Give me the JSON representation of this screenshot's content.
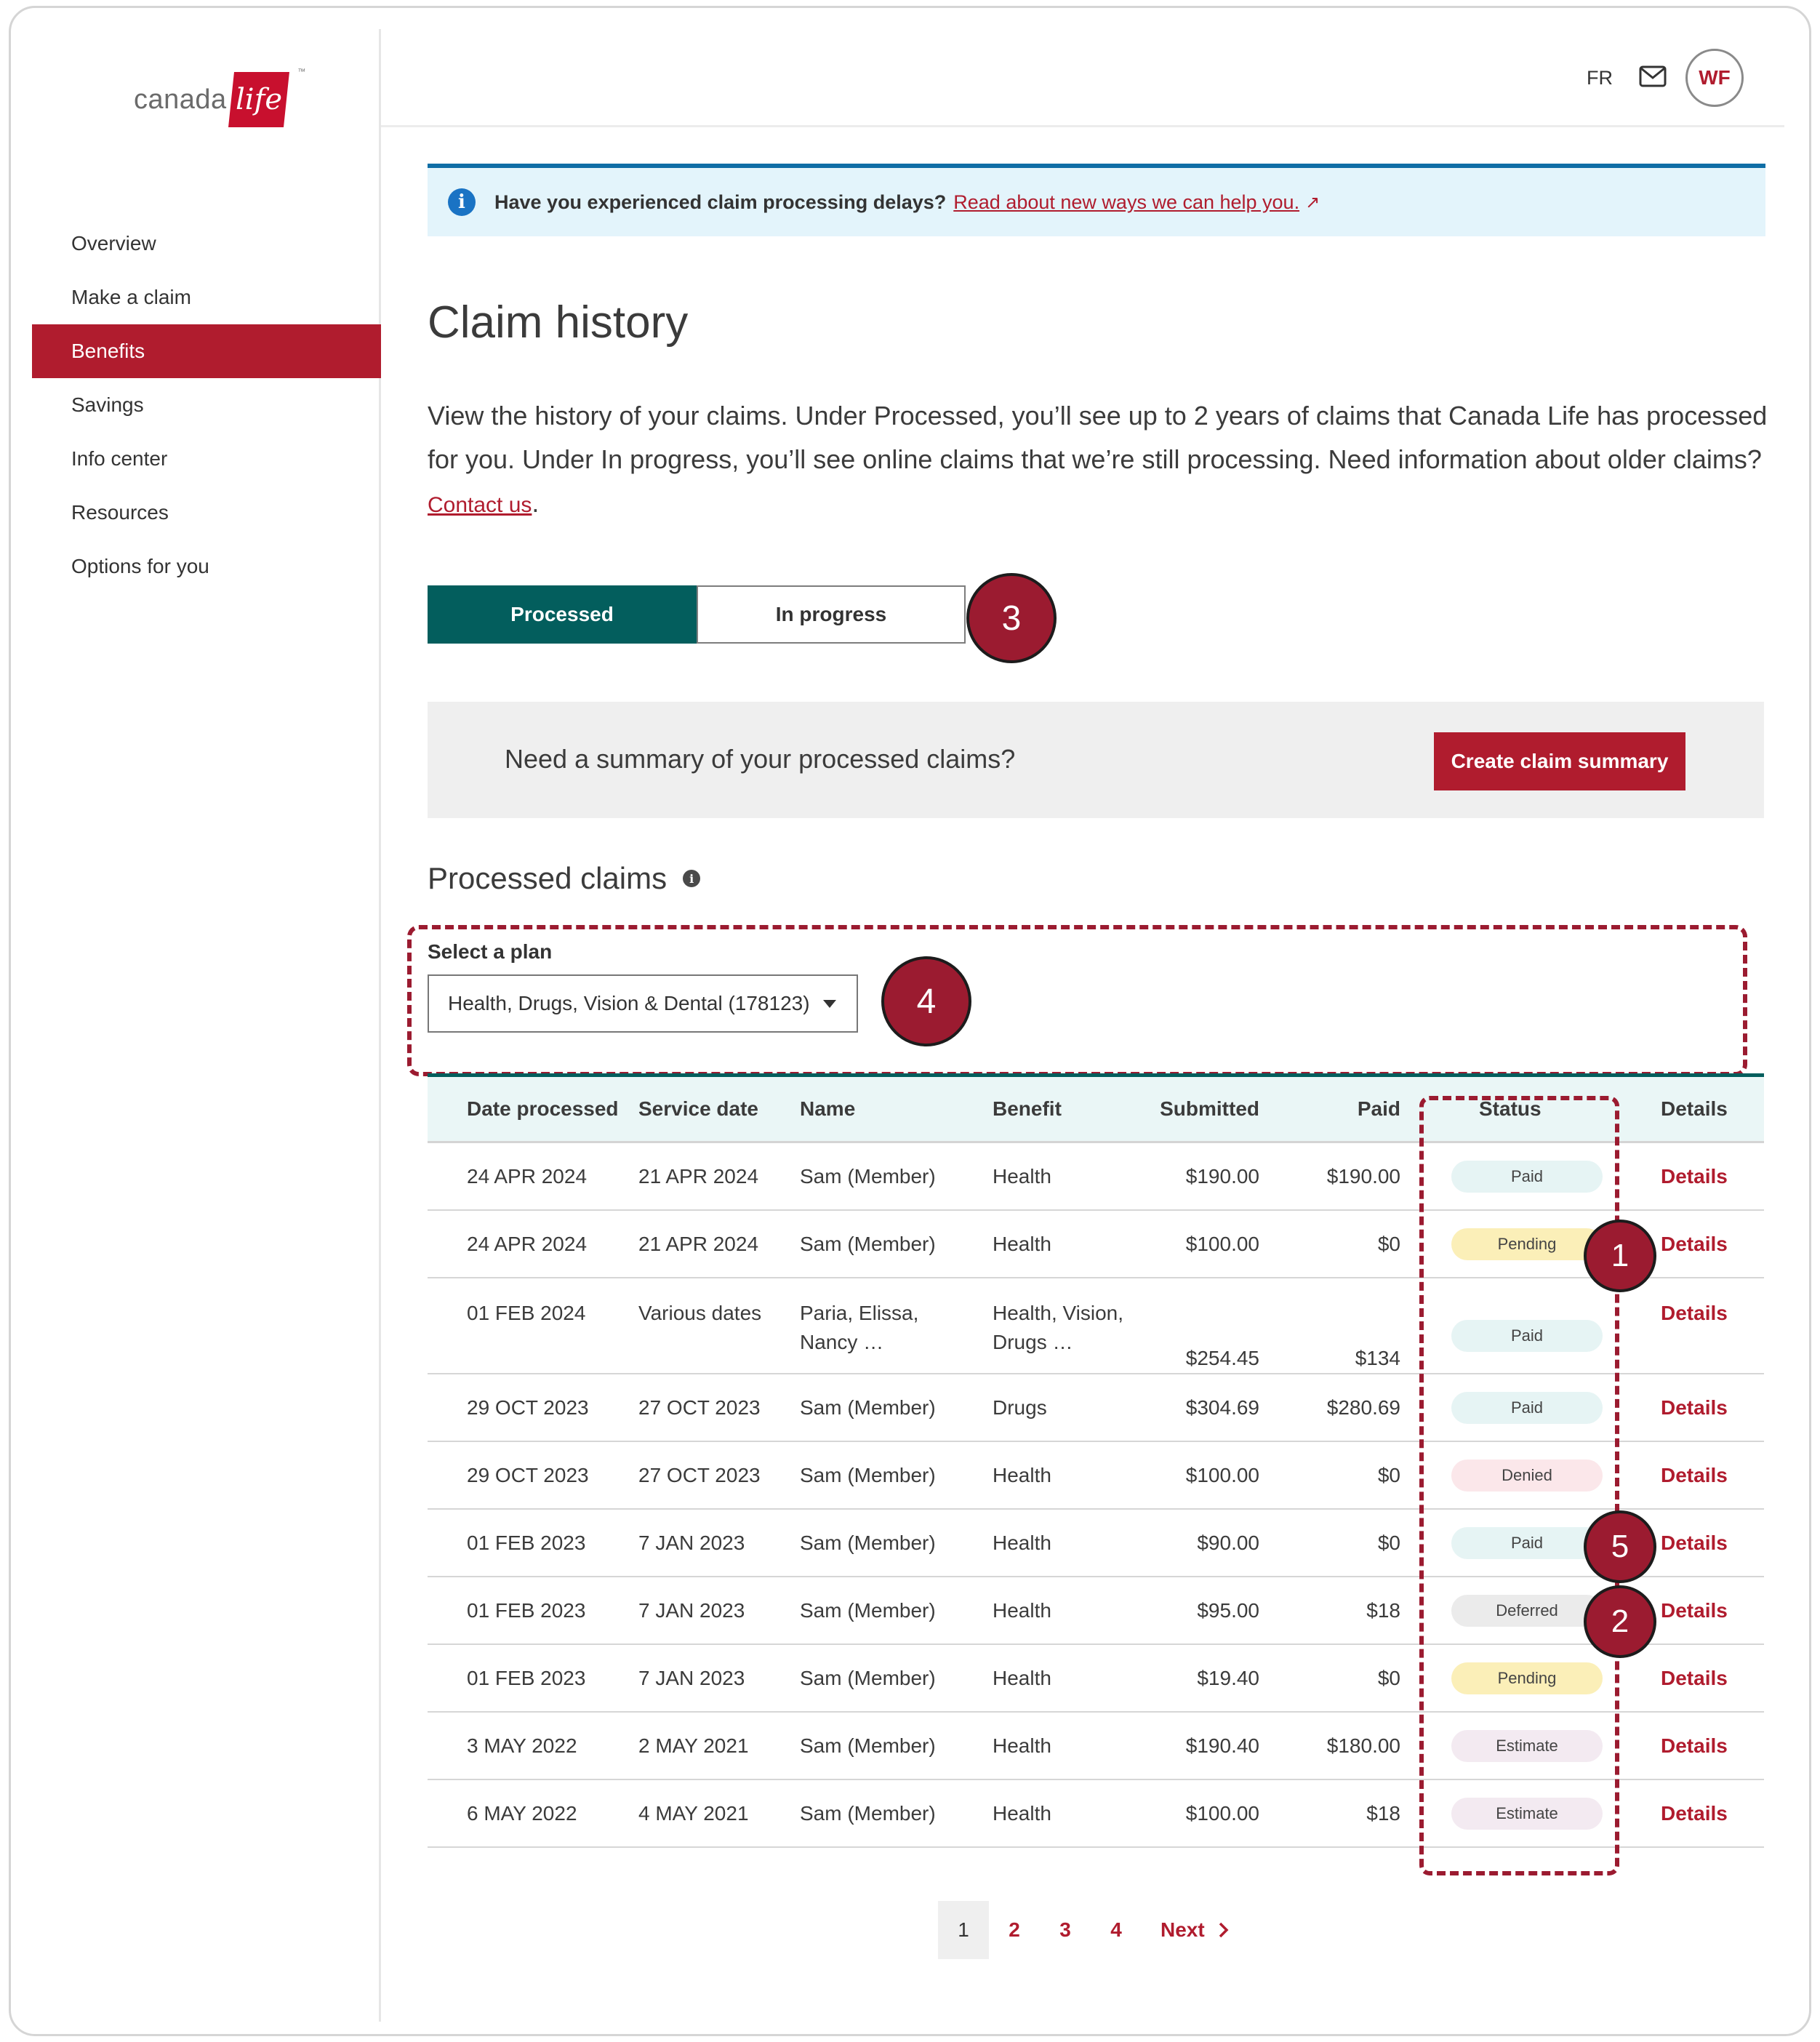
{
  "brand": {
    "word": "canada",
    "box": "life",
    "tm": "™"
  },
  "sidebar": {
    "items": [
      {
        "label": "Overview",
        "active": false
      },
      {
        "label": "Make a claim",
        "active": false
      },
      {
        "label": "Benefits",
        "active": true
      },
      {
        "label": "Savings",
        "active": false
      },
      {
        "label": "Info center",
        "active": false
      },
      {
        "label": "Resources",
        "active": false
      },
      {
        "label": "Options for you",
        "active": false
      }
    ]
  },
  "header": {
    "lang": "FR",
    "mail_icon": "mail-icon",
    "avatar": "WF"
  },
  "banner": {
    "icon": "info-icon",
    "question": "Have you experienced claim processing delays?",
    "link": "Read about new ways we can help you.",
    "ext_icon": "↗"
  },
  "page": {
    "title": "Claim history",
    "intro": "View the history of your claims. Under Processed, you’ll see up to 2 years of claims that Canada Life has processed for you. Under In progress, you’ll see online claims that we’re still processing. Need information about older claims?",
    "contact_link": "Contact us",
    "intro_end": "."
  },
  "tabs": [
    {
      "label": "Processed",
      "active": true
    },
    {
      "label": "In progress",
      "active": false
    }
  ],
  "summary": {
    "text": "Need a summary of  your processed claims?",
    "button": "Create claim summary"
  },
  "processed": {
    "title": "Processed claims",
    "plan_label": "Select a plan",
    "plan_value": "Health, Drugs, Vision & Dental (178123)"
  },
  "table": {
    "headers": [
      "Date processed",
      "Service date",
      "Name",
      "Benefit",
      "Submitted",
      "Paid",
      "Status",
      "Details"
    ],
    "rows": [
      {
        "date": "24 APR 2024",
        "service": "21 APR 2024",
        "name": "Sam (Member)",
        "name2": "",
        "benefit": "Health",
        "benefit2": "",
        "submitted": "$190.00",
        "paid": "$190.00",
        "status": "Paid",
        "details": "Details"
      },
      {
        "date": "24 APR 2024",
        "service": "21 APR 2024",
        "name": "Sam (Member)",
        "name2": "",
        "benefit": "Health",
        "benefit2": "",
        "submitted": "$100.00",
        "paid": "$0",
        "status": "Pending",
        "details": "Details"
      },
      {
        "date": "01 FEB 2024",
        "service": "Various dates",
        "name": "Paria, Elissa,",
        "name2": "Nancy …",
        "benefit": "Health, Vision,",
        "benefit2": "Drugs …",
        "submitted": "$254.45",
        "paid": "$134",
        "status": "Paid",
        "details": "Details"
      },
      {
        "date": "29 OCT 2023",
        "service": "27 OCT 2023",
        "name": "Sam (Member)",
        "name2": "",
        "benefit": "Drugs",
        "benefit2": "",
        "submitted": "$304.69",
        "paid": "$280.69",
        "status": "Paid",
        "details": "Details"
      },
      {
        "date": "29 OCT 2023",
        "service": "27 OCT 2023",
        "name": "Sam (Member)",
        "name2": "",
        "benefit": "Health",
        "benefit2": "",
        "submitted": "$100.00",
        "paid": "$0",
        "status": "Denied",
        "details": "Details"
      },
      {
        "date": "01 FEB 2023",
        "service": "7 JAN 2023",
        "name": "Sam (Member)",
        "name2": "",
        "benefit": "Health",
        "benefit2": "",
        "submitted": "$90.00",
        "paid": "$0",
        "status": "Paid",
        "details": "Details"
      },
      {
        "date": "01 FEB 2023",
        "service": "7 JAN 2023",
        "name": "Sam (Member)",
        "name2": "",
        "benefit": "Health",
        "benefit2": "",
        "submitted": "$95.00",
        "paid": "$18",
        "status": "Deferred",
        "details": "Details"
      },
      {
        "date": "01 FEB 2023",
        "service": "7 JAN 2023",
        "name": "Sam (Member)",
        "name2": "",
        "benefit": "Health",
        "benefit2": "",
        "submitted": "$19.40",
        "paid": "$0",
        "status": "Pending",
        "details": "Details"
      },
      {
        "date": "3 MAY 2022",
        "service": "2 MAY 2021",
        "name": "Sam (Member)",
        "name2": "",
        "benefit": "Health",
        "benefit2": "",
        "submitted": "$190.40",
        "paid": "$180.00",
        "status": "Estimate",
        "details": "Details"
      },
      {
        "date": "6 MAY 2022",
        "service": "4 MAY 2021",
        "name": "Sam (Member)",
        "name2": "",
        "benefit": "Health",
        "benefit2": "",
        "submitted": "$100.00",
        "paid": "$18",
        "status": "Estimate",
        "details": "Details"
      }
    ]
  },
  "pagination": {
    "pages": [
      "1",
      "2",
      "3",
      "4"
    ],
    "current": "1",
    "next": "Next"
  },
  "annotations": [
    "1",
    "2",
    "3",
    "4",
    "5"
  ],
  "colors": {
    "brand_red": "#b01c2e",
    "teal": "#035e5d",
    "annotation": "#9b1b30",
    "banner_bg": "#e3f4fb"
  }
}
